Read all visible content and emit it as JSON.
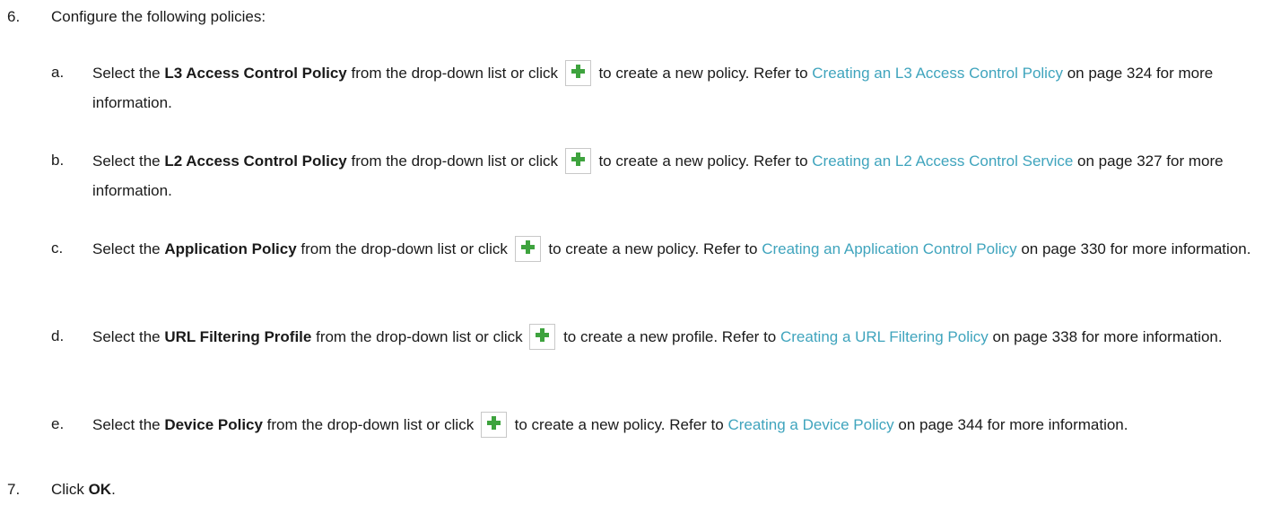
{
  "steps": {
    "six": {
      "number": "6.",
      "text": "Configure the following policies:"
    },
    "seven": {
      "number": "7.",
      "prefix": "Click ",
      "bold": "OK",
      "suffix": "."
    }
  },
  "substeps": [
    {
      "letter": "a.",
      "pre": "Select the ",
      "bold": "L3 Access Control Policy",
      "mid": " from the drop-down list or click ",
      "post": " to create a new policy. Refer to ",
      "link": "Creating an L3 Access Control Policy",
      "tail": " on page 324 for more information."
    },
    {
      "letter": "b.",
      "pre": "Select the ",
      "bold": "L2 Access Control Policy",
      "mid": " from the drop-down list or click ",
      "post": " to create a new policy. Refer to ",
      "link": "Creating an L2 Access Control Service",
      "tail": " on page 327 for more information."
    },
    {
      "letter": "c.",
      "pre": "Select the ",
      "bold": "Application Policy",
      "mid": " from the drop-down list or click ",
      "post": " to create a new policy. Refer to ",
      "link": "Creating an Application Control Policy",
      "tail": " on page 330 for more information."
    },
    {
      "letter": "d.",
      "pre": "Select the ",
      "bold": "URL Filtering Profile",
      "mid": " from the drop-down list or click ",
      "post": " to create a new profile. Refer to ",
      "link": "Creating a URL Filtering Policy",
      "tail": " on page 338 for more information."
    },
    {
      "letter": "e.",
      "pre": "Select the ",
      "bold": "Device Policy",
      "mid": " from the drop-down list or click ",
      "post": " to create a new policy. Refer to ",
      "link": "Creating a Device Policy",
      "tail": " on page 344 for more information."
    }
  ],
  "icons": {
    "add": "plus-icon",
    "plus_color": "#3ea33e"
  },
  "colors": {
    "link": "#3fa4bd",
    "text": "#1a1a1a"
  }
}
